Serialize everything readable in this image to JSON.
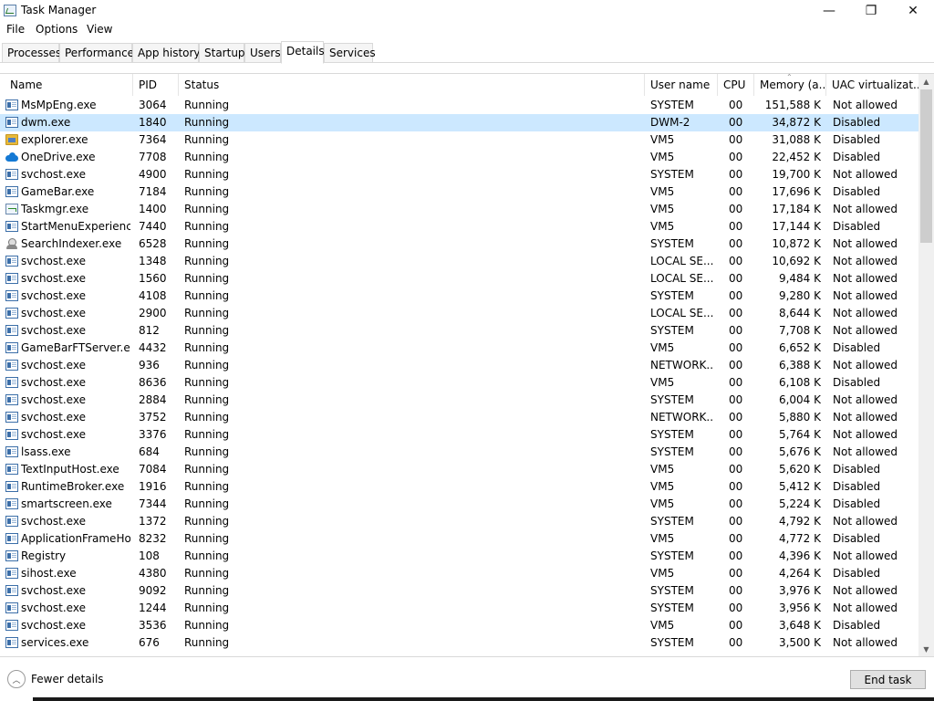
{
  "window": {
    "title": "Task Manager",
    "minimize_glyph": "—",
    "maximize_glyph": "❐",
    "close_glyph": "✕"
  },
  "menu": {
    "file": "File",
    "options": "Options",
    "view": "View"
  },
  "tabs": [
    {
      "label": "Processes"
    },
    {
      "label": "Performance"
    },
    {
      "label": "App history"
    },
    {
      "label": "Startup"
    },
    {
      "label": "Users"
    },
    {
      "label": "Details",
      "active": true
    },
    {
      "label": "Services"
    }
  ],
  "columns": {
    "name": "Name",
    "pid": "PID",
    "status": "Status",
    "user": "User name",
    "cpu": "CPU",
    "memory": "Memory (a...",
    "uac": "UAC virtualizat..."
  },
  "sort_glyph": "⌃",
  "rows": [
    {
      "icon": "window",
      "name": "MsMpEng.exe",
      "pid": "3064",
      "status": "Running",
      "user": "SYSTEM",
      "cpu": "00",
      "mem": "151,588 K",
      "uac": "Not allowed"
    },
    {
      "icon": "window",
      "name": "dwm.exe",
      "pid": "1840",
      "status": "Running",
      "user": "DWM-2",
      "cpu": "00",
      "mem": "34,872 K",
      "uac": "Disabled",
      "selected": true
    },
    {
      "icon": "folder",
      "name": "explorer.exe",
      "pid": "7364",
      "status": "Running",
      "user": "VM5",
      "cpu": "00",
      "mem": "31,088 K",
      "uac": "Disabled"
    },
    {
      "icon": "cloud",
      "name": "OneDrive.exe",
      "pid": "7708",
      "status": "Running",
      "user": "VM5",
      "cpu": "00",
      "mem": "22,452 K",
      "uac": "Disabled"
    },
    {
      "icon": "window",
      "name": "svchost.exe",
      "pid": "4900",
      "status": "Running",
      "user": "SYSTEM",
      "cpu": "00",
      "mem": "19,700 K",
      "uac": "Not allowed"
    },
    {
      "icon": "window",
      "name": "GameBar.exe",
      "pid": "7184",
      "status": "Running",
      "user": "VM5",
      "cpu": "00",
      "mem": "17,696 K",
      "uac": "Disabled"
    },
    {
      "icon": "taskmgr",
      "name": "Taskmgr.exe",
      "pid": "1400",
      "status": "Running",
      "user": "VM5",
      "cpu": "00",
      "mem": "17,184 K",
      "uac": "Not allowed"
    },
    {
      "icon": "window",
      "name": "StartMenuExperienc...",
      "pid": "7440",
      "status": "Running",
      "user": "VM5",
      "cpu": "00",
      "mem": "17,144 K",
      "uac": "Disabled"
    },
    {
      "icon": "search",
      "name": "SearchIndexer.exe",
      "pid": "6528",
      "status": "Running",
      "user": "SYSTEM",
      "cpu": "00",
      "mem": "10,872 K",
      "uac": "Not allowed"
    },
    {
      "icon": "window",
      "name": "svchost.exe",
      "pid": "1348",
      "status": "Running",
      "user": "LOCAL SE...",
      "cpu": "00",
      "mem": "10,692 K",
      "uac": "Not allowed"
    },
    {
      "icon": "window",
      "name": "svchost.exe",
      "pid": "1560",
      "status": "Running",
      "user": "LOCAL SE...",
      "cpu": "00",
      "mem": "9,484 K",
      "uac": "Not allowed"
    },
    {
      "icon": "window",
      "name": "svchost.exe",
      "pid": "4108",
      "status": "Running",
      "user": "SYSTEM",
      "cpu": "00",
      "mem": "9,280 K",
      "uac": "Not allowed"
    },
    {
      "icon": "window",
      "name": "svchost.exe",
      "pid": "2900",
      "status": "Running",
      "user": "LOCAL SE...",
      "cpu": "00",
      "mem": "8,644 K",
      "uac": "Not allowed"
    },
    {
      "icon": "window",
      "name": "svchost.exe",
      "pid": "812",
      "status": "Running",
      "user": "SYSTEM",
      "cpu": "00",
      "mem": "7,708 K",
      "uac": "Not allowed"
    },
    {
      "icon": "window",
      "name": "GameBarFTServer.exe",
      "pid": "4432",
      "status": "Running",
      "user": "VM5",
      "cpu": "00",
      "mem": "6,652 K",
      "uac": "Disabled"
    },
    {
      "icon": "window",
      "name": "svchost.exe",
      "pid": "936",
      "status": "Running",
      "user": "NETWORK...",
      "cpu": "00",
      "mem": "6,388 K",
      "uac": "Not allowed"
    },
    {
      "icon": "window",
      "name": "svchost.exe",
      "pid": "8636",
      "status": "Running",
      "user": "VM5",
      "cpu": "00",
      "mem": "6,108 K",
      "uac": "Disabled"
    },
    {
      "icon": "window",
      "name": "svchost.exe",
      "pid": "2884",
      "status": "Running",
      "user": "SYSTEM",
      "cpu": "00",
      "mem": "6,004 K",
      "uac": "Not allowed"
    },
    {
      "icon": "window",
      "name": "svchost.exe",
      "pid": "3752",
      "status": "Running",
      "user": "NETWORK...",
      "cpu": "00",
      "mem": "5,880 K",
      "uac": "Not allowed"
    },
    {
      "icon": "window",
      "name": "svchost.exe",
      "pid": "3376",
      "status": "Running",
      "user": "SYSTEM",
      "cpu": "00",
      "mem": "5,764 K",
      "uac": "Not allowed"
    },
    {
      "icon": "window",
      "name": "lsass.exe",
      "pid": "684",
      "status": "Running",
      "user": "SYSTEM",
      "cpu": "00",
      "mem": "5,676 K",
      "uac": "Not allowed"
    },
    {
      "icon": "window",
      "name": "TextInputHost.exe",
      "pid": "7084",
      "status": "Running",
      "user": "VM5",
      "cpu": "00",
      "mem": "5,620 K",
      "uac": "Disabled"
    },
    {
      "icon": "window",
      "name": "RuntimeBroker.exe",
      "pid": "1916",
      "status": "Running",
      "user": "VM5",
      "cpu": "00",
      "mem": "5,412 K",
      "uac": "Disabled"
    },
    {
      "icon": "window",
      "name": "smartscreen.exe",
      "pid": "7344",
      "status": "Running",
      "user": "VM5",
      "cpu": "00",
      "mem": "5,224 K",
      "uac": "Disabled"
    },
    {
      "icon": "window",
      "name": "svchost.exe",
      "pid": "1372",
      "status": "Running",
      "user": "SYSTEM",
      "cpu": "00",
      "mem": "4,792 K",
      "uac": "Not allowed"
    },
    {
      "icon": "window",
      "name": "ApplicationFrameHo...",
      "pid": "8232",
      "status": "Running",
      "user": "VM5",
      "cpu": "00",
      "mem": "4,772 K",
      "uac": "Disabled"
    },
    {
      "icon": "window",
      "name": "Registry",
      "pid": "108",
      "status": "Running",
      "user": "SYSTEM",
      "cpu": "00",
      "mem": "4,396 K",
      "uac": "Not allowed"
    },
    {
      "icon": "window",
      "name": "sihost.exe",
      "pid": "4380",
      "status": "Running",
      "user": "VM5",
      "cpu": "00",
      "mem": "4,264 K",
      "uac": "Disabled"
    },
    {
      "icon": "window",
      "name": "svchost.exe",
      "pid": "9092",
      "status": "Running",
      "user": "SYSTEM",
      "cpu": "00",
      "mem": "3,976 K",
      "uac": "Not allowed"
    },
    {
      "icon": "window",
      "name": "svchost.exe",
      "pid": "1244",
      "status": "Running",
      "user": "SYSTEM",
      "cpu": "00",
      "mem": "3,956 K",
      "uac": "Not allowed"
    },
    {
      "icon": "window",
      "name": "svchost.exe",
      "pid": "3536",
      "status": "Running",
      "user": "VM5",
      "cpu": "00",
      "mem": "3,648 K",
      "uac": "Disabled"
    },
    {
      "icon": "window",
      "name": "services.exe",
      "pid": "676",
      "status": "Running",
      "user": "SYSTEM",
      "cpu": "00",
      "mem": "3,500 K",
      "uac": "Not allowed"
    }
  ],
  "scrollbar": {
    "up_glyph": "▲",
    "down_glyph": "▼"
  },
  "footer": {
    "fewer_details": "Fewer details",
    "fewer_glyph": "︿",
    "end_task": "End task"
  },
  "colors": {
    "selected_row": "#cce8ff",
    "accent": "#0078d7"
  }
}
